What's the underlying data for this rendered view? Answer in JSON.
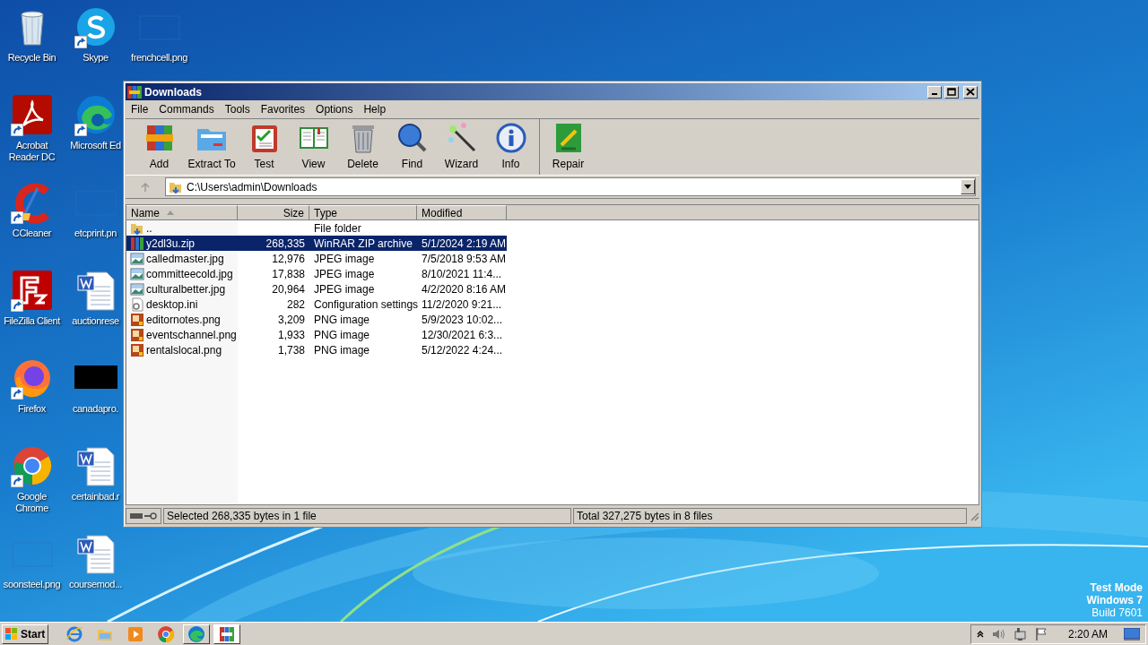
{
  "desktop": {
    "icons": [
      {
        "label": "Recycle Bin",
        "kind": "recycle",
        "shortcut": false
      },
      {
        "label": "Acrobat Reader DC",
        "kind": "pdf",
        "shortcut": true
      },
      {
        "label": "CCleaner",
        "kind": "ccleaner",
        "shortcut": true
      },
      {
        "label": "FileZilla Client",
        "kind": "filezilla",
        "shortcut": true
      },
      {
        "label": "Firefox",
        "kind": "firefox",
        "shortcut": true
      },
      {
        "label": "Google Chrome",
        "kind": "chrome",
        "shortcut": true
      },
      {
        "label": "soonsteel.png",
        "shortcut": false
      },
      {
        "label": "Skype",
        "kind": "skype",
        "shortcut": true
      },
      {
        "label": "Microsoft Ed",
        "kind": "edge",
        "shortcut": true
      },
      {
        "label": "etcprint.pn",
        "shortcut": false
      },
      {
        "label": "auctionrese",
        "kind": "word",
        "shortcut": false
      },
      {
        "label": "canadapro.",
        "kind": "dark-image",
        "shortcut": false
      },
      {
        "label": "certainbad.r",
        "kind": "word",
        "shortcut": false
      },
      {
        "label": "coursemod...",
        "kind": "word",
        "shortcut": false
      },
      {
        "label": "frenchcell.png",
        "shortcut": false
      }
    ],
    "os_notice": [
      "Test Mode",
      "Windows 7",
      "Build 7601"
    ]
  },
  "window": {
    "title": "Downloads",
    "menu": [
      "File",
      "Commands",
      "Tools",
      "Favorites",
      "Options",
      "Help"
    ],
    "toolbar_groups": [
      {
        "buttons": [
          {
            "label": "Add",
            "kind": "add"
          },
          {
            "label": "Extract To",
            "kind": "extract"
          },
          {
            "label": "Test",
            "kind": "test"
          },
          {
            "label": "View",
            "kind": "view"
          },
          {
            "label": "Delete",
            "kind": "delete"
          },
          {
            "label": "Find",
            "kind": "find"
          },
          {
            "label": "Wizard",
            "kind": "wizard"
          },
          {
            "label": "Info",
            "kind": "info"
          }
        ]
      },
      {
        "buttons": [
          {
            "label": "Repair",
            "kind": "repair"
          }
        ]
      }
    ],
    "address": "C:\\Users\\admin\\Downloads",
    "columns": [
      {
        "label": "Name",
        "sorted": true
      },
      {
        "label": "Size",
        "sorted": false
      },
      {
        "label": "Type",
        "sorted": false
      },
      {
        "label": "Modified",
        "sorted": false
      }
    ],
    "rows": [
      {
        "name": "..",
        "type": "File folder",
        "kind": "folder",
        "selected": false
      },
      {
        "name": "y2dl3u.zip",
        "size": "268,335",
        "type": "WinRAR ZIP archive",
        "modified": "5/1/2024 2:19 AM",
        "kind": "zip",
        "selected": true
      },
      {
        "name": "calledmaster.jpg",
        "size": "12,976",
        "type": "JPEG image",
        "modified": "7/5/2018 9:53 AM",
        "kind": "jpg",
        "selected": false
      },
      {
        "name": "committeecold.jpg",
        "size": "17,838",
        "type": "JPEG image",
        "modified": "8/10/2021 11:4...",
        "kind": "jpg",
        "selected": false
      },
      {
        "name": "culturalbetter.jpg",
        "size": "20,964",
        "type": "JPEG image",
        "modified": "4/2/2020 8:16 AM",
        "kind": "jpg",
        "selected": false
      },
      {
        "name": "desktop.ini",
        "size": "282",
        "type": "Configuration settings",
        "modified": "11/2/2020 9:21...",
        "kind": "ini",
        "selected": false
      },
      {
        "name": "editornotes.png",
        "size": "3,209",
        "type": "PNG image",
        "modified": "5/9/2023 10:02...",
        "kind": "png",
        "selected": false
      },
      {
        "name": "eventschannel.png",
        "size": "1,933",
        "type": "PNG image",
        "modified": "12/30/2021 6:3...",
        "kind": "png",
        "selected": false
      },
      {
        "name": "rentalslocal.png",
        "size": "1,738",
        "type": "PNG image",
        "modified": "5/12/2022 4:24...",
        "kind": "png",
        "selected": false
      }
    ],
    "status_left": "Selected 268,335 bytes in 1 file",
    "status_right": "Total 327,275 bytes in 8 files"
  },
  "taskbar": {
    "start": "Start",
    "apps": [
      {
        "kind": "ie",
        "open": false,
        "active": false
      },
      {
        "kind": "explorer",
        "open": false,
        "active": false
      },
      {
        "kind": "media",
        "open": false,
        "active": false
      },
      {
        "kind": "chrome",
        "open": false,
        "active": false
      },
      {
        "kind": "edge",
        "open": true,
        "active": false
      },
      {
        "kind": "winrar",
        "open": true,
        "active": true
      }
    ],
    "clock": "2:20 AM"
  }
}
